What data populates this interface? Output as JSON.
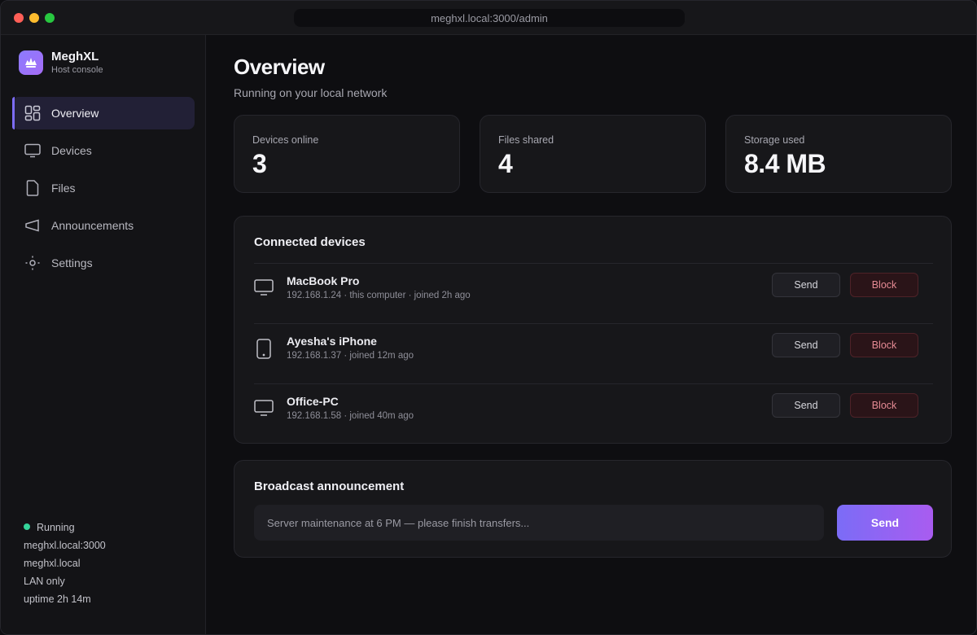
{
  "browser": {
    "url": "meghxl.local:3000/admin"
  },
  "brand": {
    "name": "MeghXL",
    "subtitle": "Host console"
  },
  "sidebar": {
    "items": [
      {
        "label": "Overview",
        "icon": "grid-icon",
        "active": true
      },
      {
        "label": "Devices",
        "icon": "monitor-icon",
        "active": false
      },
      {
        "label": "Files",
        "icon": "file-icon",
        "active": false
      },
      {
        "label": "Announcements",
        "icon": "megaphone-icon",
        "active": false
      },
      {
        "label": "Settings",
        "icon": "gear-icon",
        "active": false
      }
    ],
    "status": {
      "state": "Running",
      "host": "meghxl.local:3000",
      "hostname": "meghxl.local",
      "network": "LAN only",
      "uptime": "uptime 2h 14m"
    }
  },
  "header": {
    "title": "Overview",
    "subtitle": "Running on your local network"
  },
  "stats": [
    {
      "label": "Devices online",
      "value": "3"
    },
    {
      "label": "Files shared",
      "value": "4"
    },
    {
      "label": "Storage used",
      "value": "8.4 MB"
    }
  ],
  "devices": {
    "title": "Connected devices",
    "send_label": "Send",
    "block_label": "Block",
    "rows": [
      {
        "name": "MacBook Pro",
        "meta": "192.168.1.24 · this computer · joined 2h ago",
        "icon": "laptop-icon"
      },
      {
        "name": "Ayesha's iPhone",
        "meta": "192.168.1.37 · joined 12m ago",
        "icon": "phone-icon"
      },
      {
        "name": "Office-PC",
        "meta": "192.168.1.58 · joined 40m ago",
        "icon": "desktop-icon"
      }
    ]
  },
  "broadcast": {
    "title": "Broadcast announcement",
    "placeholder": "Server maintenance at 6 PM — please finish transfers...",
    "send_label": "Send"
  },
  "colors": {
    "accent": "#7c6cf6",
    "status_running": "#34d399",
    "block": "#e58a94"
  }
}
